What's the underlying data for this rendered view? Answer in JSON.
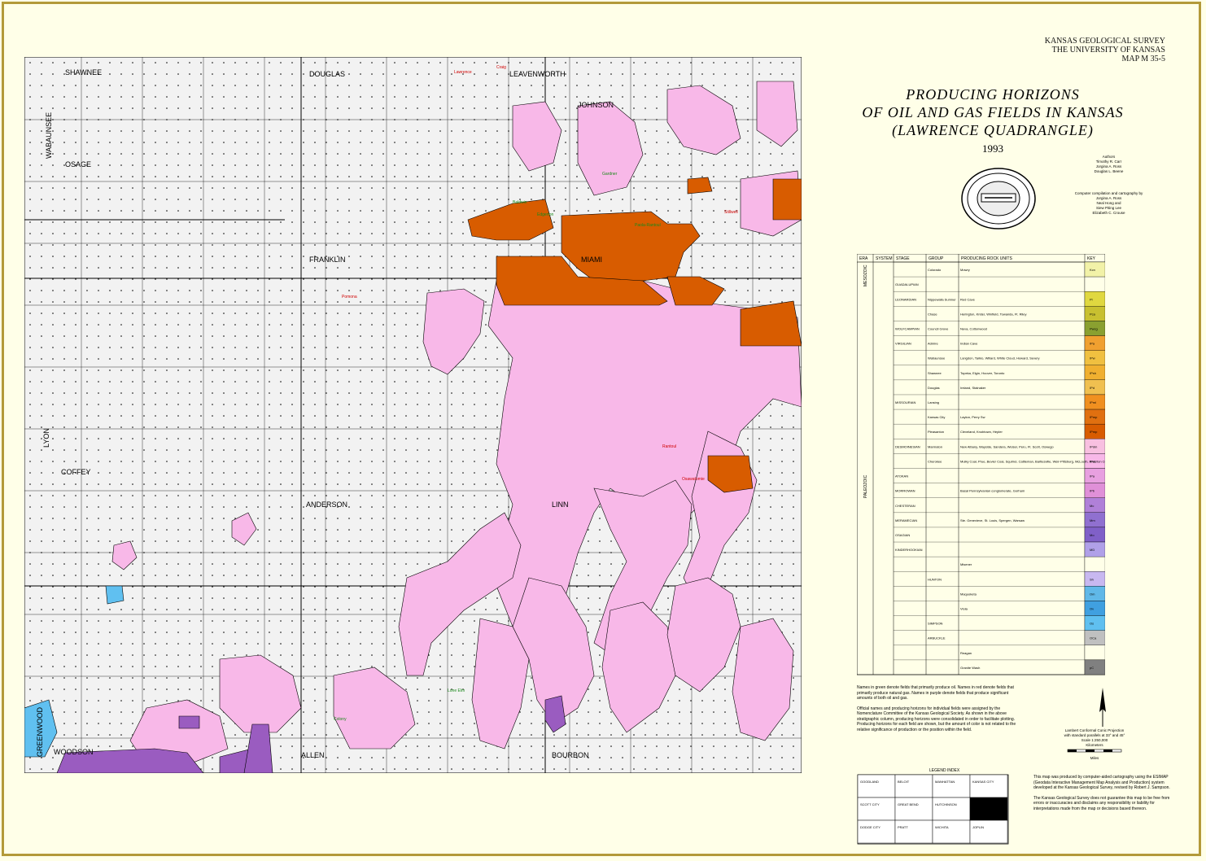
{
  "header": {
    "org_line1": "KANSAS GEOLOGICAL SURVEY",
    "org_line2": "THE UNIVERSITY OF KANSAS",
    "map_id": "MAP M 35-5"
  },
  "title": {
    "line1": "PRODUCING HORIZONS",
    "line2": "OF OIL AND GAS FIELDS IN KANSAS",
    "line3": "(LAWRENCE QUADRANGLE)",
    "year": "1993"
  },
  "credits": {
    "authors_label": "Authors",
    "authors": [
      "Timothy R. Carr",
      "Jorgina A. Ross",
      "Douglas L. Beene"
    ],
    "cartography_label": "Computer compilation and cartography by",
    "cartographers": [
      "Jorgina A. Ross",
      "Neal Hong and",
      "Siew Piting Lee",
      "Elizabeth C. Crouse"
    ]
  },
  "counties": [
    "SHAWNEE",
    "DOUGLAS",
    "LEAVENWORTH",
    "JOHNSON",
    "WABAUNSEE",
    "OSAGE",
    "FRANKLIN",
    "MIAMI",
    "LYON",
    "COFFEY",
    "ANDERSON",
    "LINN",
    "GREENWOOD",
    "WOODSON",
    "ALLEN",
    "BOURBON"
  ],
  "fields_oil_labels": [
    "Baldwin",
    "Edgerton",
    "Gardner",
    "Paola-Rantoul",
    "Lone Elm",
    "Colony"
  ],
  "fields_gas_labels": [
    "Lawrence",
    "Craig",
    "Pomona",
    "Rantoul",
    "Stillwell",
    "Osawatomie"
  ],
  "strat_table": {
    "col_headers": [
      "ERA",
      "SYSTEM",
      "STAGE",
      "GROUP",
      "PRODUCING ROCK UNITS",
      "KEY"
    ],
    "eras": [
      "MESOZOIC",
      "PALEOZOIC"
    ],
    "rows": [
      {
        "stage": "",
        "group": "Colorado",
        "units": "Mowry",
        "key": "Kcn",
        "color": "#f2f2a8"
      },
      {
        "stage": "GUADALUPIAN",
        "group": "",
        "units": "",
        "key": "",
        "color": "#ffffe8"
      },
      {
        "stage": "LEONARDIAN",
        "group": "Nippewalla Sumner",
        "units": "Red Cave",
        "key": "Pl",
        "color": "#e0d840"
      },
      {
        "stage": "",
        "group": "Chase",
        "units": "Herington, Krider, Winfield, Towanda, Ft. Riley",
        "key": "Pca",
        "color": "#c8c030"
      },
      {
        "stage": "WOLFCAMPIAN",
        "group": "Council Grove",
        "units": "Neva, Cottonwood",
        "key": "Pwcg",
        "color": "#8aa030"
      },
      {
        "stage": "VIRGILIAN",
        "group": "Admire",
        "units": "Indian Cave",
        "key": "IPa",
        "color": "#f0a030"
      },
      {
        "stage": "",
        "group": "Wabaunsee",
        "units": "Langdon, Tarkio, Willard, White Cloud, Howard, Severy",
        "key": "IPw",
        "color": "#f0c040"
      },
      {
        "stage": "",
        "group": "Shawnee",
        "units": "Topeka, Elgin, Hoover, Toronto",
        "key": "IPsh",
        "color": "#f0b030"
      },
      {
        "stage": "",
        "group": "Douglas",
        "units": "Ireland, Stalnaker",
        "key": "IPd",
        "color": "#f0c050"
      },
      {
        "stage": "MISSOURIAN",
        "group": "Lansing",
        "units": "",
        "key": "IPml",
        "color": "#f09020"
      },
      {
        "stage": "",
        "group": "Kansas City",
        "units": "Layton, Perry Sw",
        "key": "IPmp",
        "color": "#e07010"
      },
      {
        "stage": "",
        "group": "Pleasanton",
        "units": "Cleveland, Knobtown, Hepler",
        "key": "IPmp",
        "color": "#d85c00"
      },
      {
        "stage": "DESMOINESIAN",
        "group": "Marmaton",
        "units": "New Albany, Wayside, Sandera, Weiser, Peru, Ft. Scott, Oswego",
        "key": "IPdm",
        "color": "#f8c0e0"
      },
      {
        "stage": "",
        "group": "Cherokee",
        "units": "Mulky Coal, Prue, Bevier Coal, Squirrel, Cattleman, Bartlesville, Weir-Pittsburg, McLouth, Riverton Coal, Burgess",
        "key": "IPdc",
        "color": "#f8b8e8"
      },
      {
        "stage": "ATOKAN",
        "group": "",
        "units": "",
        "key": "IPa",
        "color": "#e8a0e0"
      },
      {
        "stage": "MORROWAN",
        "group": "",
        "units": "Basal Pennsylvanian conglomerate, Gorham",
        "key": "IPb",
        "color": "#e090d8"
      },
      {
        "stage": "CHESTERAN",
        "group": "",
        "units": "",
        "key": "Mc",
        "color": "#b080d8"
      },
      {
        "stage": "MERAMECIAN",
        "group": "",
        "units": "Ste. Genevieve, St. Louis, Spergen, Warsaw",
        "key": "Mm",
        "color": "#9070d0"
      },
      {
        "stage": "OSAGIAN",
        "group": "",
        "units": "",
        "key": "Mo",
        "color": "#8060c8"
      },
      {
        "stage": "KINDERHOOKIAN",
        "group": "",
        "units": "",
        "key": "MD",
        "color": "#b0a0e8"
      },
      {
        "stage": "",
        "group": "",
        "units": "Misener",
        "key": "",
        "color": "#ffffe8"
      },
      {
        "stage": "",
        "group": "HUNTON",
        "units": "",
        "key": "Sh",
        "color": "#c8b8f0"
      },
      {
        "stage": "",
        "group": "",
        "units": "Maquoketa",
        "key": "Om",
        "color": "#60b8e8"
      },
      {
        "stage": "",
        "group": "",
        "units": "Viola",
        "key": "Ov",
        "color": "#40a0e0"
      },
      {
        "stage": "",
        "group": "SIMPSON",
        "units": "",
        "key": "Os",
        "color": "#60c0f0"
      },
      {
        "stage": "",
        "group": "ARBUCKLE",
        "units": "",
        "key": "OCa",
        "color": "#c0c0c0"
      },
      {
        "stage": "",
        "group": "",
        "units": "Reagan",
        "key": "",
        "color": "#ffffe8"
      },
      {
        "stage": "",
        "group": "",
        "units": "Granite Wash",
        "key": "pC",
        "color": "#808080"
      }
    ]
  },
  "notes": {
    "p1": "Names in green denote fields that primarily produce oil. Names in red denote fields that primarily produce natural gas. Names in purple denote fields that produce significant amounts of both oil and gas.",
    "p2": "Official names and producing horizons for individual fields were assigned by the Nomenclature Committee of the Kansas Geological Society. As shown in the above stratigraphic column, producing horizons were consolidated in order to facilitate plotting. Producing horizons for each field are shown, but the amount of color is not related to the relative significance of production or the position within the field."
  },
  "projection": {
    "line1": "Lambert Conformal Conic Projection",
    "line2": "with standard parallels at 33° and 45°",
    "scale": "Scale 1:250,000",
    "unit1": "Kilometers",
    "unit2": "Miles"
  },
  "disclaimer": {
    "p1": "This map was produced by computer-aided cartography using the ESIMAP (Geodata Interactive Management Map Analysis and Production) system developed at the Kansas Geological Survey, revised by Robert J. Sampson.",
    "p2": "The Kansas Geological Survey does not guarantee this map to be free from errors or inaccuracies and disclaims any responsibility or liability for interpretations made from the map or decisions based thereon."
  },
  "locator": {
    "top_label": "LEGEND INDEX",
    "cells": [
      "GOODLAND",
      "BELOIT",
      "MANHATTAN",
      "KANSAS CITY",
      "SCOTT CITY",
      "GREAT BEND",
      "HUTCHINSON",
      "",
      "DODGE CITY",
      "PRATT",
      "WICHITA",
      "JOPLIN"
    ]
  },
  "colors": {
    "frame": "#b39a3a",
    "pink": "#f8b8e8",
    "orange": "#d85c00",
    "purple": "#9a5cc0",
    "gray_grid": "#f0f0f0"
  }
}
